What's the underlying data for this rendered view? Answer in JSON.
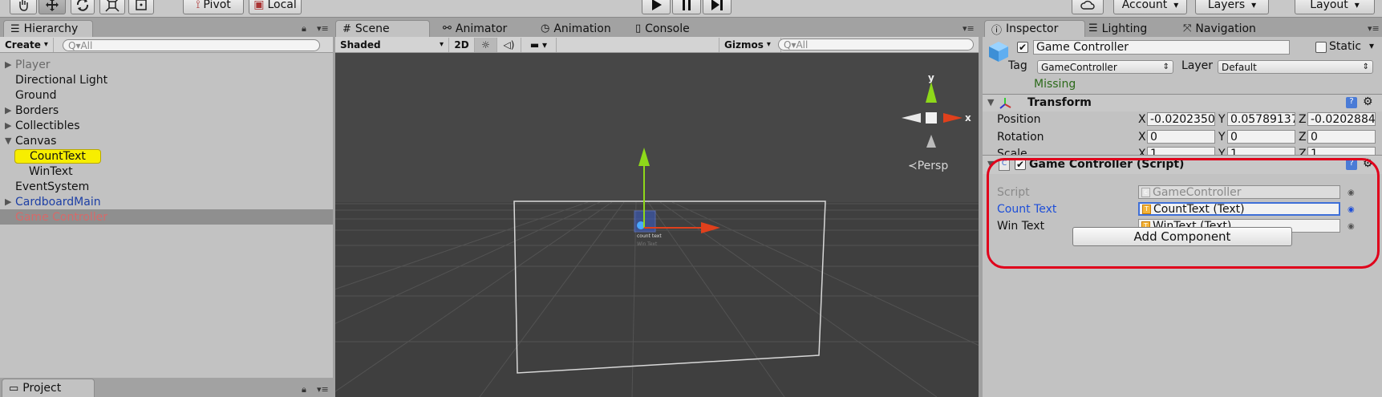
{
  "toolbar": {
    "pivot": "Pivot",
    "local": "Local",
    "account": "Account",
    "layers": "Layers",
    "layout": "Layout"
  },
  "hierarchy": {
    "tab": "Hierarchy",
    "create": "Create",
    "search_placeholder": "Q▾All",
    "items": [
      {
        "label": "Player",
        "expand": true,
        "indent": 0,
        "style": "grey"
      },
      {
        "label": "Directional Light",
        "expand": false,
        "indent": 0,
        "style": "normal"
      },
      {
        "label": "Ground",
        "expand": false,
        "indent": 0,
        "style": "normal"
      },
      {
        "label": "Borders",
        "expand": true,
        "indent": 0,
        "style": "normal"
      },
      {
        "label": "Collectibles",
        "expand": true,
        "indent": 0,
        "style": "normal"
      },
      {
        "label": "Canvas",
        "expand": true,
        "indent": 0,
        "style": "normal",
        "open": true
      },
      {
        "label": "CountText",
        "expand": false,
        "indent": 1,
        "style": "highlight"
      },
      {
        "label": "WinText",
        "expand": false,
        "indent": 1,
        "style": "normal"
      },
      {
        "label": "EventSystem",
        "expand": false,
        "indent": 0,
        "style": "normal"
      },
      {
        "label": "CardboardMain",
        "expand": true,
        "indent": 0,
        "style": "blue"
      },
      {
        "label": "Game Controller",
        "expand": false,
        "indent": 0,
        "style": "selected"
      }
    ]
  },
  "project": {
    "tab": "Project"
  },
  "scene": {
    "tabs": [
      "Scene",
      "Animator",
      "Animation",
      "Console"
    ],
    "shading": "Shaded",
    "mode_2d": "2D",
    "gizmos": "Gizmos",
    "search_placeholder": "Q▾All",
    "persp": "≺Persp",
    "gizmo_x": "x",
    "gizmo_y": "y",
    "object_label_1": "count text",
    "object_label_2": "Win Text"
  },
  "inspector": {
    "tabs": [
      "Inspector",
      "Lighting",
      "Navigation"
    ],
    "object_name": "Game Controller",
    "static_label": "Static",
    "tag_label": "Tag",
    "tag_value": "GameController",
    "layer_label": "Layer",
    "layer_value": "Default",
    "missing": "Missing",
    "transform": {
      "title": "Transform",
      "rows": [
        {
          "label": "Position",
          "x": "-0.0202350",
          "y": "0.05789137",
          "z": "-0.0202884"
        },
        {
          "label": "Rotation",
          "x": "0",
          "y": "0",
          "z": "0"
        },
        {
          "label": "Scale",
          "x": "1",
          "y": "1",
          "z": "1"
        }
      ]
    },
    "script_component": {
      "title": "Game Controller (Script)",
      "rows": [
        {
          "label": "Script",
          "value": "GameController",
          "style": "readonly"
        },
        {
          "label": "Count Text",
          "value": "CountText (Text)",
          "style": "active"
        },
        {
          "label": "Win Text",
          "value": "WinText (Text)",
          "style": "normal"
        }
      ],
      "add_component": "Add Component"
    },
    "annotation_color": "#e0001b"
  }
}
